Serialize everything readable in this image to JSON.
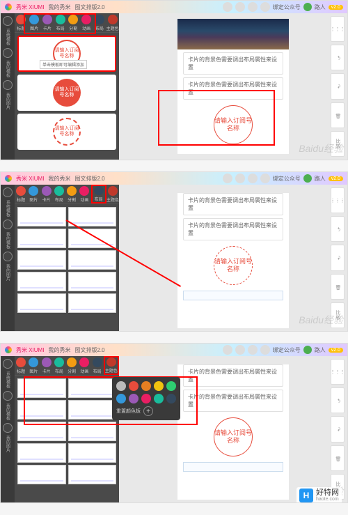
{
  "titlebar": {
    "app": "秀米 XIUMI",
    "mine": "我的秀米",
    "editor": "图文排版2.0",
    "bind_hint": "绑定公众号",
    "user": "路人",
    "badge": "v2.0"
  },
  "leftbar": {
    "items": [
      "系统模板",
      "我的模板",
      "我的图片"
    ]
  },
  "toolbar": {
    "items": [
      "标题",
      "图片",
      "卡片",
      "布局",
      "分割",
      "动画",
      "布局",
      "主题色"
    ]
  },
  "circle_text": "请输入订阅号名称",
  "tooltip": "单击模板即可编辑添加",
  "msg1": "卡片的背景色需要调出布局属性来设置",
  "msg2": "卡片的背景色需要调出布局属性来设置",
  "canvas_circle": "请输入订阅号名称",
  "popup": {
    "reset": "重置颜色板",
    "colors": [
      "#bbb",
      "#e74c3c",
      "#e67e22",
      "#f1c40f",
      "#2ecc71",
      "#3498db",
      "#9b59b6",
      "#e91e63",
      "#1abc9c",
      "#34495e"
    ]
  },
  "watermark": "Baidu经验",
  "footer": {
    "logo": "H",
    "name": "好特网",
    "domain": "haote.com"
  }
}
